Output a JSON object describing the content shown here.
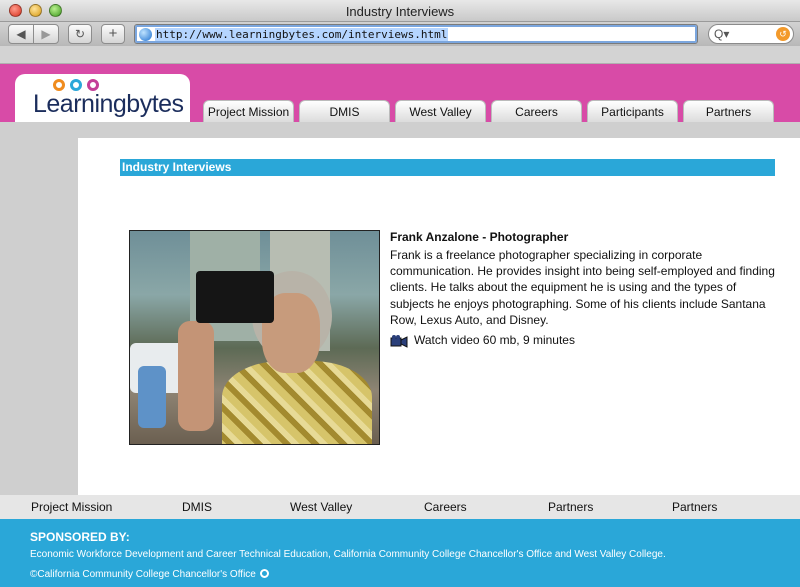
{
  "window": {
    "title": "Industry Interviews"
  },
  "toolbar": {
    "back_icon": "◀",
    "forward_icon": "▶",
    "reload_icon": "↻",
    "add_icon": "+",
    "url": "http://www.learningbytes.com/interviews.html",
    "search_icon": "Q▾",
    "snapback_icon": "↺"
  },
  "site": {
    "logo_text": "Learningbytes",
    "nav": [
      "Project Mission",
      "DMIS",
      "West Valley",
      "Careers",
      "Participants",
      "Partners"
    ]
  },
  "main": {
    "section_title": "Industry Interviews",
    "interview": {
      "title": "Frank Anzalone - Photographer",
      "description": "Frank is a freelance photographer specializing in corporate communication. He provides insight into being self-employed and finding clients. He talks about the equipment he is using and the types of subjects he enjoys photographing. Some of his clients include Santana Row, Lexus Auto, and Disney.",
      "video_label": "Watch video 60 mb, 9 minutes"
    }
  },
  "footer": {
    "nav": [
      "Project Mission",
      "DMIS",
      "West Valley",
      "Careers",
      "Partners",
      "Partners"
    ],
    "sponsor_heading": "SPONSORED BY:",
    "sponsor_text": "Economic Workforce Development and Career Technical Education, California Community College Chancellor's Office and West Valley College.",
    "copyright": "©California Community College Chancellor's Office"
  },
  "colors": {
    "header_magenta": "#d84ba7",
    "accent_blue": "#2aa7d8"
  }
}
